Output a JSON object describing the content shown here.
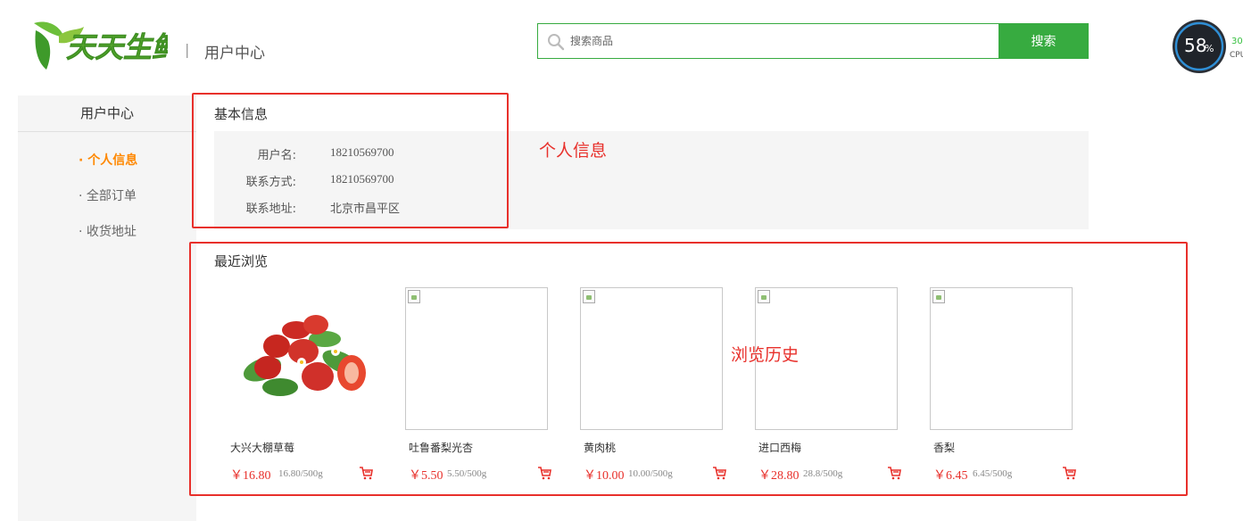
{
  "header": {
    "logo_text": "天天生鲜",
    "separator": "|",
    "page_title": "用户中心"
  },
  "search": {
    "placeholder": "搜索商品",
    "button_label": "搜索"
  },
  "cpu_widget": {
    "value": "58",
    "unit": "%",
    "side_top": "30",
    "side_bottom": "CPU"
  },
  "sidebar": {
    "title": "用户中心",
    "items": [
      {
        "label": "· 个人信息",
        "active": true
      },
      {
        "label": "· 全部订单",
        "active": false
      },
      {
        "label": "· 收货地址",
        "active": false
      }
    ]
  },
  "basic_info": {
    "title": "基本信息",
    "rows": [
      {
        "label": "用户名:",
        "value": "18210569700"
      },
      {
        "label": "联系方式:",
        "value": "18210569700"
      },
      {
        "label": "联系地址:",
        "value": "北京市昌平区"
      }
    ]
  },
  "annotations": {
    "info": "个人信息",
    "history": "浏览历史"
  },
  "recent": {
    "title": "最近浏览",
    "goods": [
      {
        "name": "大兴大棚草莓",
        "price": "￥16.80",
        "unit": "16.80/500g",
        "image": "strawberry"
      },
      {
        "name": "吐鲁番梨光杏",
        "price": "￥5.50",
        "unit": "5.50/500g",
        "image": "broken"
      },
      {
        "name": "黄肉桃",
        "price": "￥10.00",
        "unit": "10.00/500g",
        "image": "broken"
      },
      {
        "name": "进口西梅",
        "price": "￥28.80",
        "unit": "28.8/500g",
        "image": "broken"
      },
      {
        "name": "香梨",
        "price": "￥6.45",
        "unit": "6.45/500g",
        "image": "broken"
      }
    ]
  },
  "colors": {
    "brand_green": "#37ab40",
    "price_red": "#e8302b",
    "active_orange": "#ff8800",
    "annotation_red": "#e8302b"
  },
  "icons": [
    "search-icon",
    "cart-icon",
    "broken-image-icon"
  ]
}
